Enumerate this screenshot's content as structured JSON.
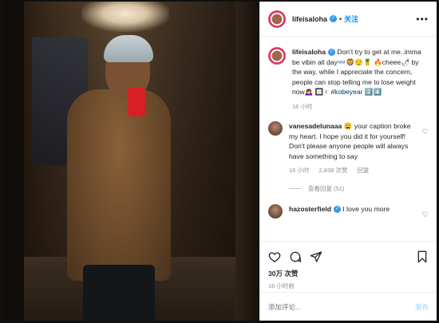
{
  "post": {
    "username": "lifeisaloha",
    "follow_label": "关注",
    "more_label": "•••"
  },
  "caption": {
    "username": "lifeisaloha",
    "text": "Don't try to get at me..imma be vibin all day👓🦁😌🍍 🔥cheee🌶 by the way, while I appreciate the concern, people can stop telling me to lose weight now🙇‍♀️ 🔲♀ ",
    "hashtag": "#kobeyear",
    "suffix": " 2️⃣4️⃣",
    "time": "16 小时"
  },
  "comments": [
    {
      "username": "vanesadelunaaa",
      "text": "😩 your caption broke my heart. I hope you did it for yourself! Don't please anyone people will always have something to say",
      "time": "16 小时",
      "likes": "2,838 次赞",
      "reply": "回复",
      "view_replies": "查看回复 (51)"
    },
    {
      "username": "hazosterfield",
      "text": "I love you more"
    }
  ],
  "stats": {
    "likes": "30万 次赞",
    "time": "16 小时前"
  },
  "composer": {
    "placeholder": "添加评论...",
    "post_label": "发布"
  }
}
